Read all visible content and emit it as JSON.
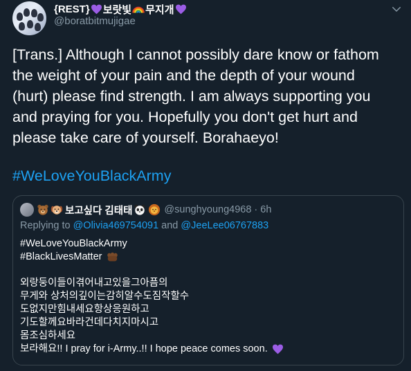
{
  "author": {
    "display_name_prefix": "{REST}",
    "display_name_mid": "보랏빛",
    "display_name_suffix": "무지개",
    "handle": "@boratbitmujigae"
  },
  "tweet": {
    "lines": [
      "[Trans.] Although I cannot possibly dare know or fathom",
      "the weight of your pain and the depth of your wound",
      "(hurt) please find strength. I am always supporting you",
      "and praying for you. Hopefully you don't get hurt and",
      "please take care of yourself. Borahaeyo!"
    ],
    "hashtag": "#WeLoveYouBlackArmy"
  },
  "quoted": {
    "name": "보고싶다 김태태",
    "handle": "@sunghyoung4968",
    "separator": "·",
    "time": "6h",
    "replying_label": "Replying to",
    "reply_to_1": "@Olivia469754091",
    "reply_and": "and",
    "reply_to_2": "@JeeLee06767883",
    "hashtag_1": "#WeLoveYouBlackArmy",
    "hashtag_2": "#BlackLivesMatter",
    "korean_lines": [
      "외랑둥이들이겪어내고있을그아픔의",
      "무게와 상처의깊이는감히알수도짐작할수",
      "도없지만힘내세요항상응원하고",
      "기도할께요바라건데다치지마시고",
      "몸조심하세요"
    ],
    "closing_line": "보라해요!! I pray for i-Army..!! I hope peace comes soon."
  },
  "icons": {
    "caret": "chevron-down-icon",
    "heart": "purple-heart-icon",
    "rainbow": "rainbow-icon",
    "bear": "bear-face-icon",
    "dog": "dog-face-icon",
    "panda": "panda-face-icon",
    "lion": "lion-face-icon",
    "fist": "raised-fist-icon"
  },
  "colors": {
    "background": "#15202b",
    "link": "#1da1f2",
    "muted": "#8899a6",
    "border": "#38444d",
    "heart": "#9b5de5"
  }
}
